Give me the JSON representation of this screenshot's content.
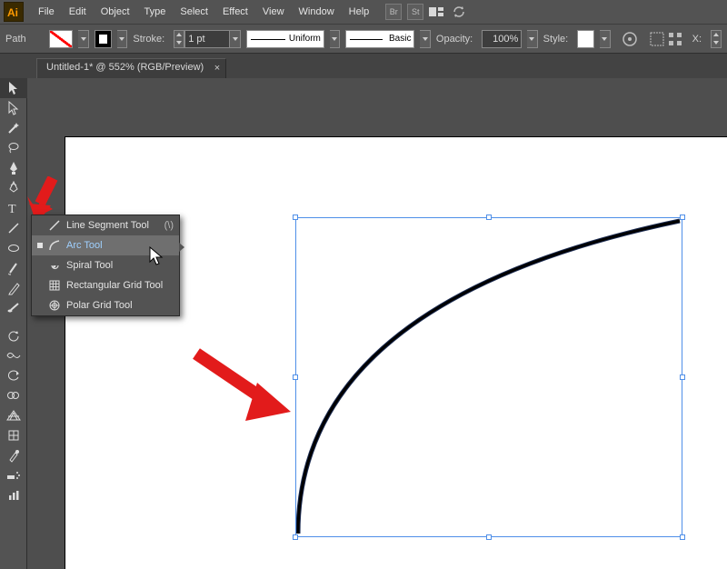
{
  "app": {
    "name": "Ai"
  },
  "menu": [
    "File",
    "Edit",
    "Object",
    "Type",
    "Select",
    "Effect",
    "View",
    "Window",
    "Help"
  ],
  "control": {
    "selection": "Path",
    "strokeLabel": "Stroke:",
    "strokeValue": "1 pt",
    "dashLabel": "Uniform",
    "brushLabel": "Basic",
    "opacityLabel": "Opacity:",
    "opacityValue": "100%",
    "styleLabel": "Style:",
    "xLabel": "X:"
  },
  "tab": {
    "label": "Untitled-1* @ 552% (RGB/Preview)"
  },
  "flyout": {
    "items": [
      {
        "label": "Line Segment Tool",
        "kb": "(\\)"
      },
      {
        "label": "Arc Tool",
        "kb": ""
      },
      {
        "label": "Spiral Tool",
        "kb": ""
      },
      {
        "label": "Rectangular Grid Tool",
        "kb": ""
      },
      {
        "label": "Polar Grid Tool",
        "kb": ""
      }
    ]
  }
}
